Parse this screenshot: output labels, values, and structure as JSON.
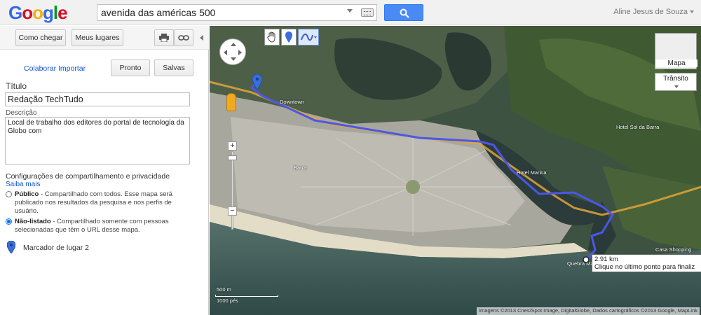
{
  "header": {
    "logo_letters": [
      {
        "char": "G",
        "color": "#3369e8"
      },
      {
        "char": "o",
        "color": "#d50f25"
      },
      {
        "char": "o",
        "color": "#eeb211"
      },
      {
        "char": "g",
        "color": "#3369e8"
      },
      {
        "char": "l",
        "color": "#009925"
      },
      {
        "char": "e",
        "color": "#d50f25"
      }
    ],
    "search_value": "avenida das américas 500",
    "user_name": "Aline Jesus de Souza"
  },
  "toolbar": {
    "directions_label": "Como chegar",
    "my_places_label": "Meus lugares"
  },
  "panel": {
    "collaborate_label": "Colaborar",
    "import_label": "Importar",
    "done_label": "Pronto",
    "save_label": "Salvas",
    "title_label": "Título",
    "title_value": "Redação TechTudo",
    "description_label": "Descrição",
    "description_value": "Local de trabalho dos editores do portal de tecnologia da Globo com",
    "privacy_title": "Configurações de compartilhamento e privacidade",
    "learn_more": "Saiba mais",
    "public_title": "Público",
    "public_text": " - Compartilhado com todos. Esse mapa será publicado nos resultados da pesquisa e nos perfis de usuário.",
    "unlisted_title": "Não-listado",
    "unlisted_text": " - Compartilhado somente com pessoas selecionadas que têm o URL desse mapa.",
    "placemark_label": "Marcador de lugar 2"
  },
  "map": {
    "maptype_label": "Mapa",
    "traffic_label": "Trânsito",
    "distance": "2.91 km",
    "distance_hint": "Clique no último ponto para finaliz",
    "scale_metric": "500 m",
    "scale_imperial": "1000 pés",
    "attribution": "Imagens ©2013 Cnes/Spot Image, DigitalGlobe, Dados cartográficos ©2013 Google, MapLink",
    "labels": [
      "Downtown",
      "Barra",
      "Hotel Marina",
      "Quebra Mar",
      "Hotel Sol da Barra",
      "Casa Shopping"
    ]
  },
  "colors": {
    "accent": "#4a8af4",
    "route": "#4b57e8",
    "link": "#1155cc"
  }
}
